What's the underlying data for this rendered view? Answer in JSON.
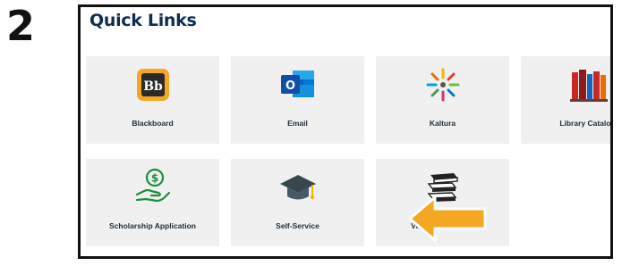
{
  "step": {
    "number": "2"
  },
  "quick_links": {
    "title": "Quick Links",
    "tiles": [
      {
        "label": "Blackboard",
        "icon": "blackboard-icon",
        "icon_text": "Bb"
      },
      {
        "label": "Email",
        "icon": "outlook-email-icon",
        "icon_text": "O"
      },
      {
        "label": "Kaltura",
        "icon": "kaltura-icon"
      },
      {
        "label": "Library Catalog",
        "icon": "library-books-icon"
      },
      {
        "label": "Scholarship Application",
        "icon": "scholarship-hand-dollar-icon"
      },
      {
        "label": "Self-Service",
        "icon": "graduation-cap-icon"
      },
      {
        "label": "Virtual Bookstore",
        "icon": "book-stack-icon"
      }
    ]
  },
  "annotation": {
    "icon": "pointer-arrow-icon",
    "color": "#f5a623"
  },
  "colors": {
    "title": "#0c2e54",
    "tile_bg": "#f0f0f0",
    "frame": "#111111"
  }
}
